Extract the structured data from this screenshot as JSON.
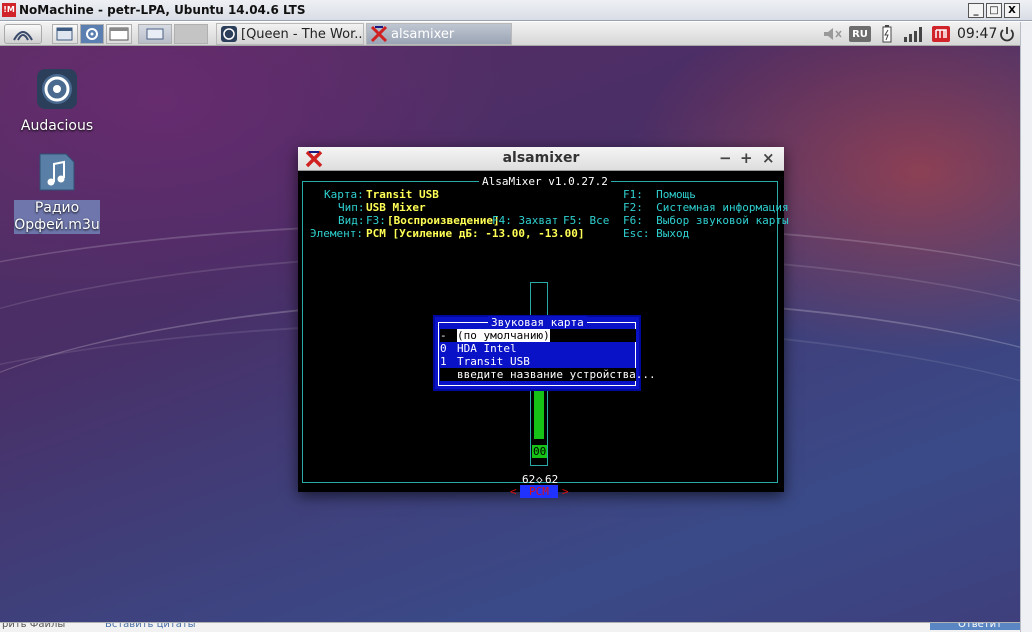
{
  "nomachine": {
    "title": "NoMachine - petr-LPA, Ubuntu 14.04.6 LTS",
    "logo": "!M",
    "controls": {
      "minimize": "_",
      "maximize": "□",
      "close": "X"
    }
  },
  "panel": {
    "tasks": [
      {
        "label": "[Queen - The Wor...",
        "icon": "audacious-icon"
      },
      {
        "label": "alsamixer",
        "icon": "xterm-icon"
      }
    ],
    "keyboard_layout": "RU",
    "clock": "09:47"
  },
  "desktop_icons": [
    {
      "label": "Audacious",
      "icon": "audacious-icon"
    },
    {
      "label": "Радио Орфей.m3u",
      "icon": "music-file-icon"
    }
  ],
  "window": {
    "title": "alsamixer",
    "controls": {
      "minimize": "−",
      "maximize": "+",
      "close": "×"
    }
  },
  "alsamixer": {
    "version": "AlsaMixer v1.0.27.2",
    "card_label": "Карта:",
    "card_value": "Transit USB",
    "chip_label": "Чип:",
    "chip_value": "USB Mixer",
    "view_label": "Вид:",
    "view_f3": "F3:",
    "view_active": "[Воспроизведение]",
    "view_f4": "F4: Захват",
    "view_f5": "F5: Все",
    "element_label": "Элемент:",
    "element_value": "PCM [Усиление дБ: -13.00, -13.00]",
    "help": [
      "F1:  Помощь",
      "F2:  Системная информация",
      "F6:  Выбор звуковой карты",
      "Esc: Выход"
    ],
    "channel": {
      "volume_percent": 62,
      "value_left": "62",
      "value_right": "62",
      "mute": "00",
      "name": "PCM"
    },
    "dialog": {
      "title": "Звуковая карта",
      "items": [
        {
          "key": "-",
          "label": "(по умолчанию)"
        },
        {
          "key": "0",
          "label": "HDA Intel"
        },
        {
          "key": "1",
          "label": "Transit USB"
        },
        {
          "key": "",
          "label": "введите название устройства..."
        }
      ]
    }
  },
  "bottom_bar": {
    "left_text": "рить Файлы",
    "mid_text": "Вставить цитаты",
    "right_text": "Ответит"
  },
  "colors": {
    "term_cyan": "#2fd0d0",
    "term_yellow": "#ffff55",
    "dialog_blue": "#0a12c8",
    "slider_green": "#15c215",
    "pcm_red": "#e01010"
  }
}
